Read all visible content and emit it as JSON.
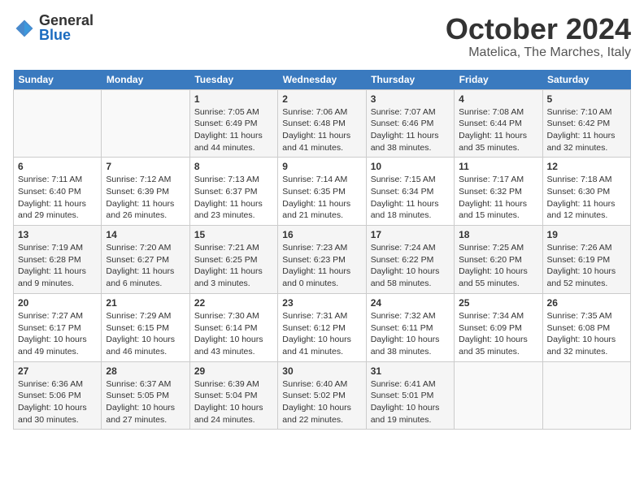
{
  "logo": {
    "text_general": "General",
    "text_blue": "Blue"
  },
  "header": {
    "month_title": "October 2024",
    "location": "Matelica, The Marches, Italy"
  },
  "days_of_week": [
    "Sunday",
    "Monday",
    "Tuesday",
    "Wednesday",
    "Thursday",
    "Friday",
    "Saturday"
  ],
  "weeks": [
    [
      {
        "day": "",
        "info": ""
      },
      {
        "day": "",
        "info": ""
      },
      {
        "day": "1",
        "info": "Sunrise: 7:05 AM\nSunset: 6:49 PM\nDaylight: 11 hours and 44 minutes."
      },
      {
        "day": "2",
        "info": "Sunrise: 7:06 AM\nSunset: 6:48 PM\nDaylight: 11 hours and 41 minutes."
      },
      {
        "day": "3",
        "info": "Sunrise: 7:07 AM\nSunset: 6:46 PM\nDaylight: 11 hours and 38 minutes."
      },
      {
        "day": "4",
        "info": "Sunrise: 7:08 AM\nSunset: 6:44 PM\nDaylight: 11 hours and 35 minutes."
      },
      {
        "day": "5",
        "info": "Sunrise: 7:10 AM\nSunset: 6:42 PM\nDaylight: 11 hours and 32 minutes."
      }
    ],
    [
      {
        "day": "6",
        "info": "Sunrise: 7:11 AM\nSunset: 6:40 PM\nDaylight: 11 hours and 29 minutes."
      },
      {
        "day": "7",
        "info": "Sunrise: 7:12 AM\nSunset: 6:39 PM\nDaylight: 11 hours and 26 minutes."
      },
      {
        "day": "8",
        "info": "Sunrise: 7:13 AM\nSunset: 6:37 PM\nDaylight: 11 hours and 23 minutes."
      },
      {
        "day": "9",
        "info": "Sunrise: 7:14 AM\nSunset: 6:35 PM\nDaylight: 11 hours and 21 minutes."
      },
      {
        "day": "10",
        "info": "Sunrise: 7:15 AM\nSunset: 6:34 PM\nDaylight: 11 hours and 18 minutes."
      },
      {
        "day": "11",
        "info": "Sunrise: 7:17 AM\nSunset: 6:32 PM\nDaylight: 11 hours and 15 minutes."
      },
      {
        "day": "12",
        "info": "Sunrise: 7:18 AM\nSunset: 6:30 PM\nDaylight: 11 hours and 12 minutes."
      }
    ],
    [
      {
        "day": "13",
        "info": "Sunrise: 7:19 AM\nSunset: 6:28 PM\nDaylight: 11 hours and 9 minutes."
      },
      {
        "day": "14",
        "info": "Sunrise: 7:20 AM\nSunset: 6:27 PM\nDaylight: 11 hours and 6 minutes."
      },
      {
        "day": "15",
        "info": "Sunrise: 7:21 AM\nSunset: 6:25 PM\nDaylight: 11 hours and 3 minutes."
      },
      {
        "day": "16",
        "info": "Sunrise: 7:23 AM\nSunset: 6:23 PM\nDaylight: 11 hours and 0 minutes."
      },
      {
        "day": "17",
        "info": "Sunrise: 7:24 AM\nSunset: 6:22 PM\nDaylight: 10 hours and 58 minutes."
      },
      {
        "day": "18",
        "info": "Sunrise: 7:25 AM\nSunset: 6:20 PM\nDaylight: 10 hours and 55 minutes."
      },
      {
        "day": "19",
        "info": "Sunrise: 7:26 AM\nSunset: 6:19 PM\nDaylight: 10 hours and 52 minutes."
      }
    ],
    [
      {
        "day": "20",
        "info": "Sunrise: 7:27 AM\nSunset: 6:17 PM\nDaylight: 10 hours and 49 minutes."
      },
      {
        "day": "21",
        "info": "Sunrise: 7:29 AM\nSunset: 6:15 PM\nDaylight: 10 hours and 46 minutes."
      },
      {
        "day": "22",
        "info": "Sunrise: 7:30 AM\nSunset: 6:14 PM\nDaylight: 10 hours and 43 minutes."
      },
      {
        "day": "23",
        "info": "Sunrise: 7:31 AM\nSunset: 6:12 PM\nDaylight: 10 hours and 41 minutes."
      },
      {
        "day": "24",
        "info": "Sunrise: 7:32 AM\nSunset: 6:11 PM\nDaylight: 10 hours and 38 minutes."
      },
      {
        "day": "25",
        "info": "Sunrise: 7:34 AM\nSunset: 6:09 PM\nDaylight: 10 hours and 35 minutes."
      },
      {
        "day": "26",
        "info": "Sunrise: 7:35 AM\nSunset: 6:08 PM\nDaylight: 10 hours and 32 minutes."
      }
    ],
    [
      {
        "day": "27",
        "info": "Sunrise: 6:36 AM\nSunset: 5:06 PM\nDaylight: 10 hours and 30 minutes."
      },
      {
        "day": "28",
        "info": "Sunrise: 6:37 AM\nSunset: 5:05 PM\nDaylight: 10 hours and 27 minutes."
      },
      {
        "day": "29",
        "info": "Sunrise: 6:39 AM\nSunset: 5:04 PM\nDaylight: 10 hours and 24 minutes."
      },
      {
        "day": "30",
        "info": "Sunrise: 6:40 AM\nSunset: 5:02 PM\nDaylight: 10 hours and 22 minutes."
      },
      {
        "day": "31",
        "info": "Sunrise: 6:41 AM\nSunset: 5:01 PM\nDaylight: 10 hours and 19 minutes."
      },
      {
        "day": "",
        "info": ""
      },
      {
        "day": "",
        "info": ""
      }
    ]
  ]
}
